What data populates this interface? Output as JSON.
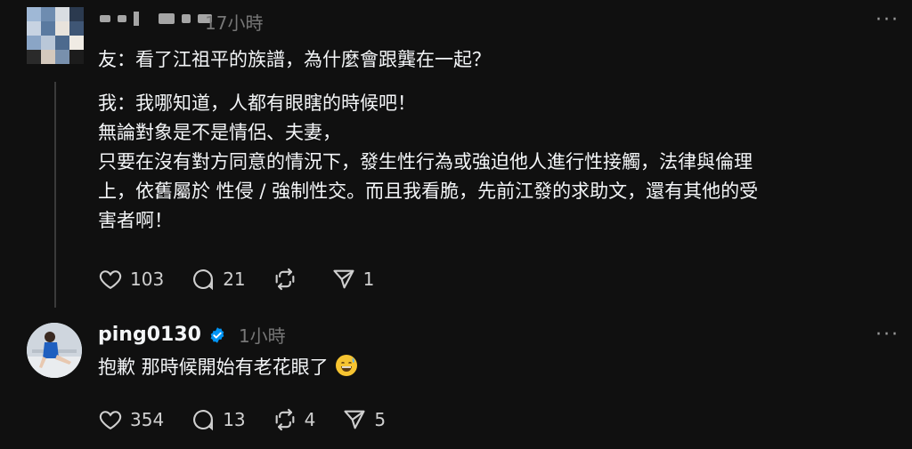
{
  "post1": {
    "time": "17小時",
    "text": "友：看了江祖平的族譜，為什麼會跟龔在一起？",
    "more_icon": "more-icon",
    "avatar_colors": [
      "#9fb8d6",
      "#6e8cb0",
      "#d9dde2",
      "#2b3a4f",
      "#c7d3e2",
      "#5a7aa0",
      "#e8e3dc",
      "#3f5675",
      "#8aa5c6",
      "#b9c7d8",
      "#4d6a8e",
      "#f0ebe4",
      "#2a2a2a",
      "#d4c9bd",
      "#7890ad",
      "#1c1c1c"
    ]
  },
  "quote": {
    "line1": "我：我哪知道，人都有眼瞎的時候吧！",
    "line2": "無論對象是不是情侶、夫妻，",
    "line3": "只要在沒有對方同意的情況下，發生性行為或強迫他人進行性接觸，法律與倫理",
    "line4": "上，依舊屬於 性侵 / 強制性交。而且我看脆，先前江發的求助文，還有其他的受",
    "line5": "害者啊！"
  },
  "actions1": {
    "likes": "103",
    "comments": "21",
    "reposts": "",
    "shares": "1"
  },
  "post2": {
    "username": "ping0130",
    "time": "1小時",
    "text": "抱歉 那時候開始有老花眼了",
    "emoji": "grinning-sweat-emoji"
  },
  "actions2": {
    "likes": "354",
    "comments": "13",
    "reposts": "4",
    "shares": "5"
  },
  "colors": {
    "background": "#101010",
    "text": "#f3f5f7",
    "muted": "#777777",
    "verified": "#0095f6"
  }
}
